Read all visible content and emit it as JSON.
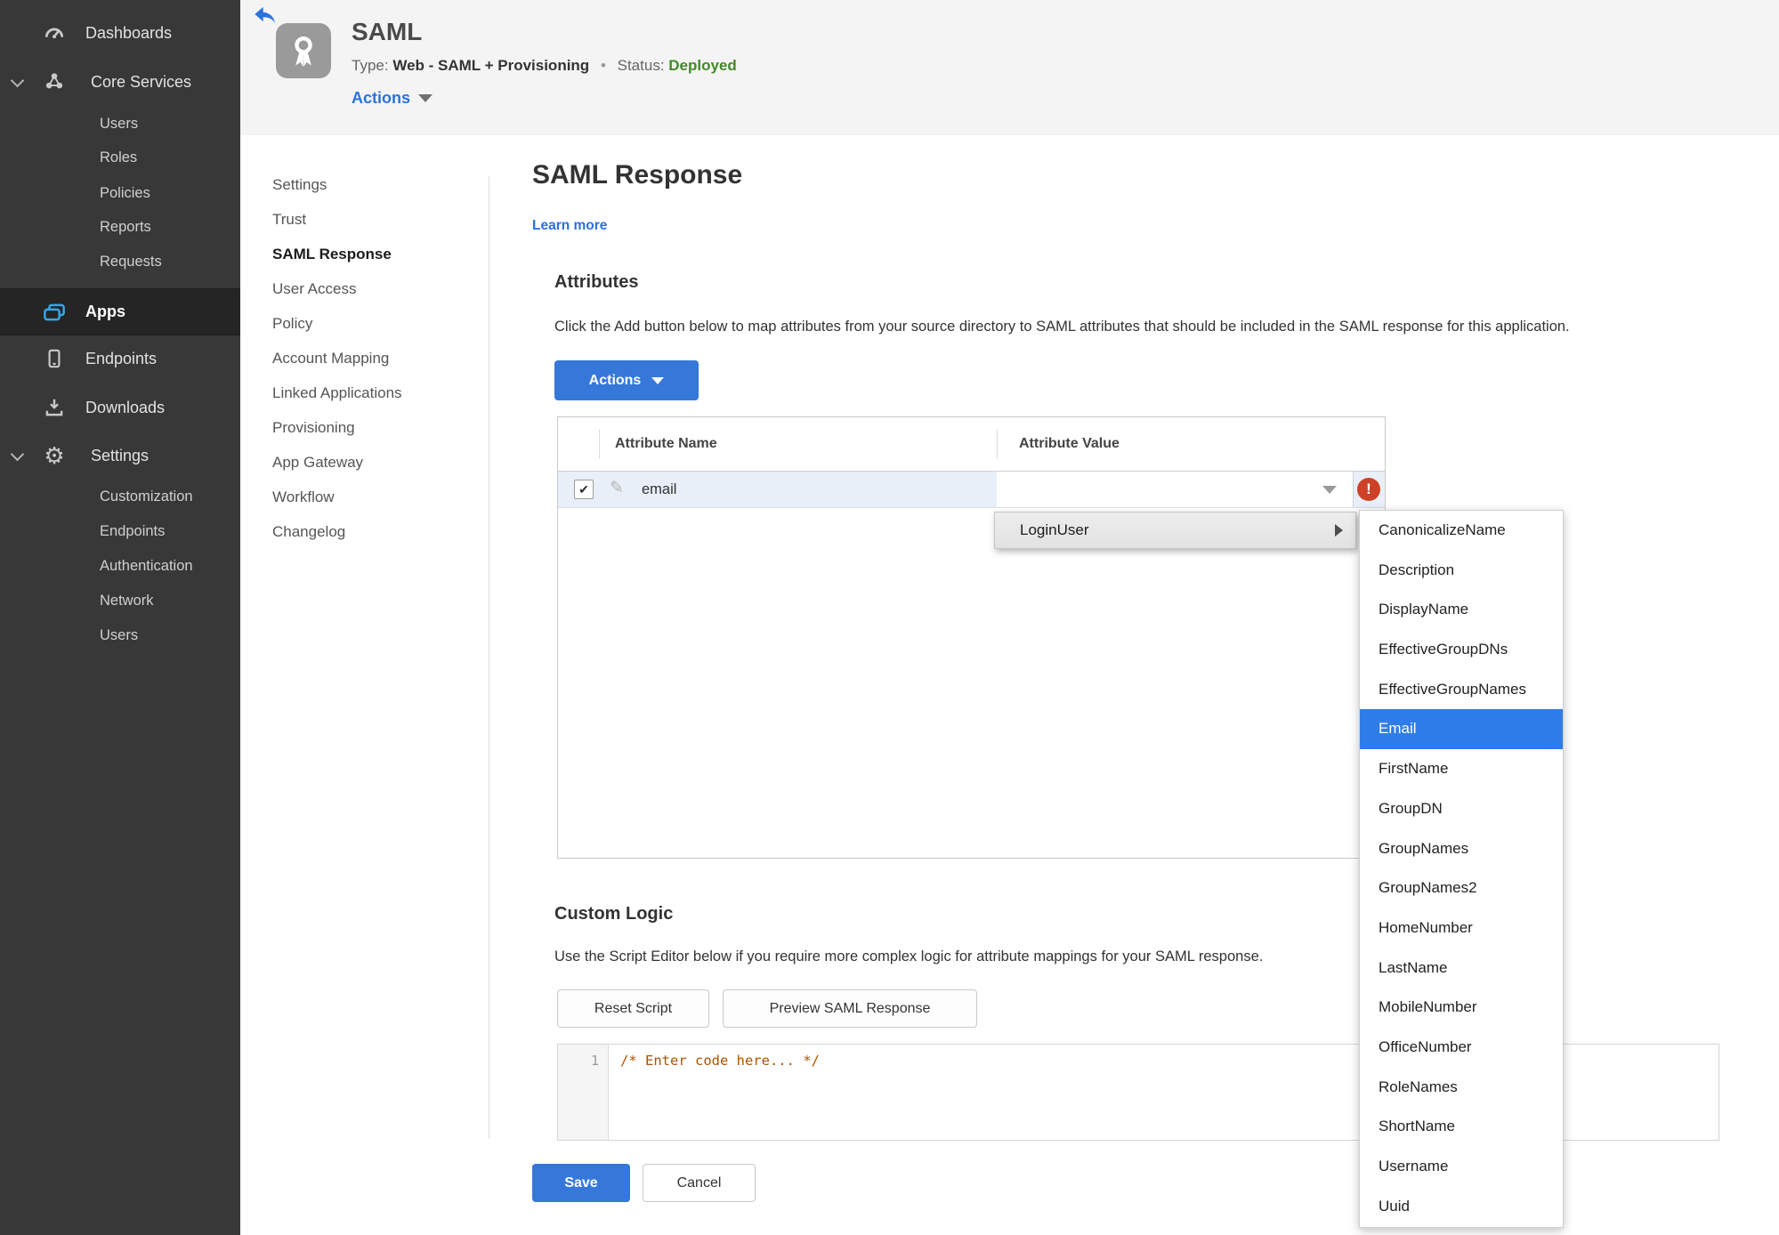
{
  "sidebar": {
    "items": [
      {
        "label": "Dashboards"
      },
      {
        "label": "Core Services"
      },
      {
        "label": "Users"
      },
      {
        "label": "Roles"
      },
      {
        "label": "Policies"
      },
      {
        "label": "Reports"
      },
      {
        "label": "Requests"
      },
      {
        "label": "Apps"
      },
      {
        "label": "Endpoints"
      },
      {
        "label": "Downloads"
      },
      {
        "label": "Settings"
      },
      {
        "label": "Customization"
      },
      {
        "label": "Endpoints"
      },
      {
        "label": "Authentication"
      },
      {
        "label": "Network"
      },
      {
        "label": "Users"
      }
    ],
    "active_item": "Apps"
  },
  "header": {
    "title": "SAML",
    "type_label": "Type:",
    "type_value": "Web - SAML + Provisioning",
    "separator": "•",
    "status_label": "Status:",
    "status_value": "Deployed",
    "actions_label": "Actions"
  },
  "subnav": {
    "items": [
      "Settings",
      "Trust",
      "SAML Response",
      "User Access",
      "Policy",
      "Account Mapping",
      "Linked Applications",
      "Provisioning",
      "App Gateway",
      "Workflow",
      "Changelog"
    ],
    "active": "SAML Response"
  },
  "main": {
    "title": "SAML Response",
    "learn_more": "Learn more",
    "attributes": {
      "heading": "Attributes",
      "description": "Click the Add button below to map attributes from your source directory to SAML attributes that should be included in the SAML response for this application.",
      "actions_button": "Actions",
      "table": {
        "headers": [
          "Attribute Name",
          "Attribute Value"
        ],
        "row": {
          "checked": "✔",
          "name": "email",
          "value": ""
        }
      }
    },
    "custom_logic": {
      "heading": "Custom Logic",
      "description": "Use the Script Editor below if you require more complex logic for attribute mappings for your SAML response.",
      "reset_button": "Reset Script",
      "preview_button": "Preview SAML Response"
    },
    "editor": {
      "line_number": "1",
      "code": "/* Enter code here... */"
    },
    "footer": {
      "save": "Save",
      "cancel": "Cancel"
    }
  },
  "dropdown_menu": {
    "label": "LoginUser"
  },
  "submenu": {
    "items": [
      "CanonicalizeName",
      "Description",
      "DisplayName",
      "EffectiveGroupDNs",
      "EffectiveGroupNames",
      "Email",
      "FirstName",
      "GroupDN",
      "GroupNames",
      "GroupNames2",
      "HomeNumber",
      "LastName",
      "MobileNumber",
      "OfficeNumber",
      "RoleNames",
      "ShortName",
      "Username",
      "Uuid"
    ],
    "selected_index": 5,
    "selected": "Email"
  },
  "colors": {
    "accent_blue": "#3578d9",
    "link_blue": "#2a6fe0",
    "status_green": "#44882b",
    "error_red": "#cf4126",
    "selection_blue": "#2e7ce8",
    "sidebar_bg": "#383838",
    "sidebar_active_bg": "#252525",
    "apps_icon_cyan": "#35a7e8",
    "header_bg": "#f4f4f4",
    "row_highlight": "#e8eff8",
    "code_comment": "#aa5500"
  }
}
